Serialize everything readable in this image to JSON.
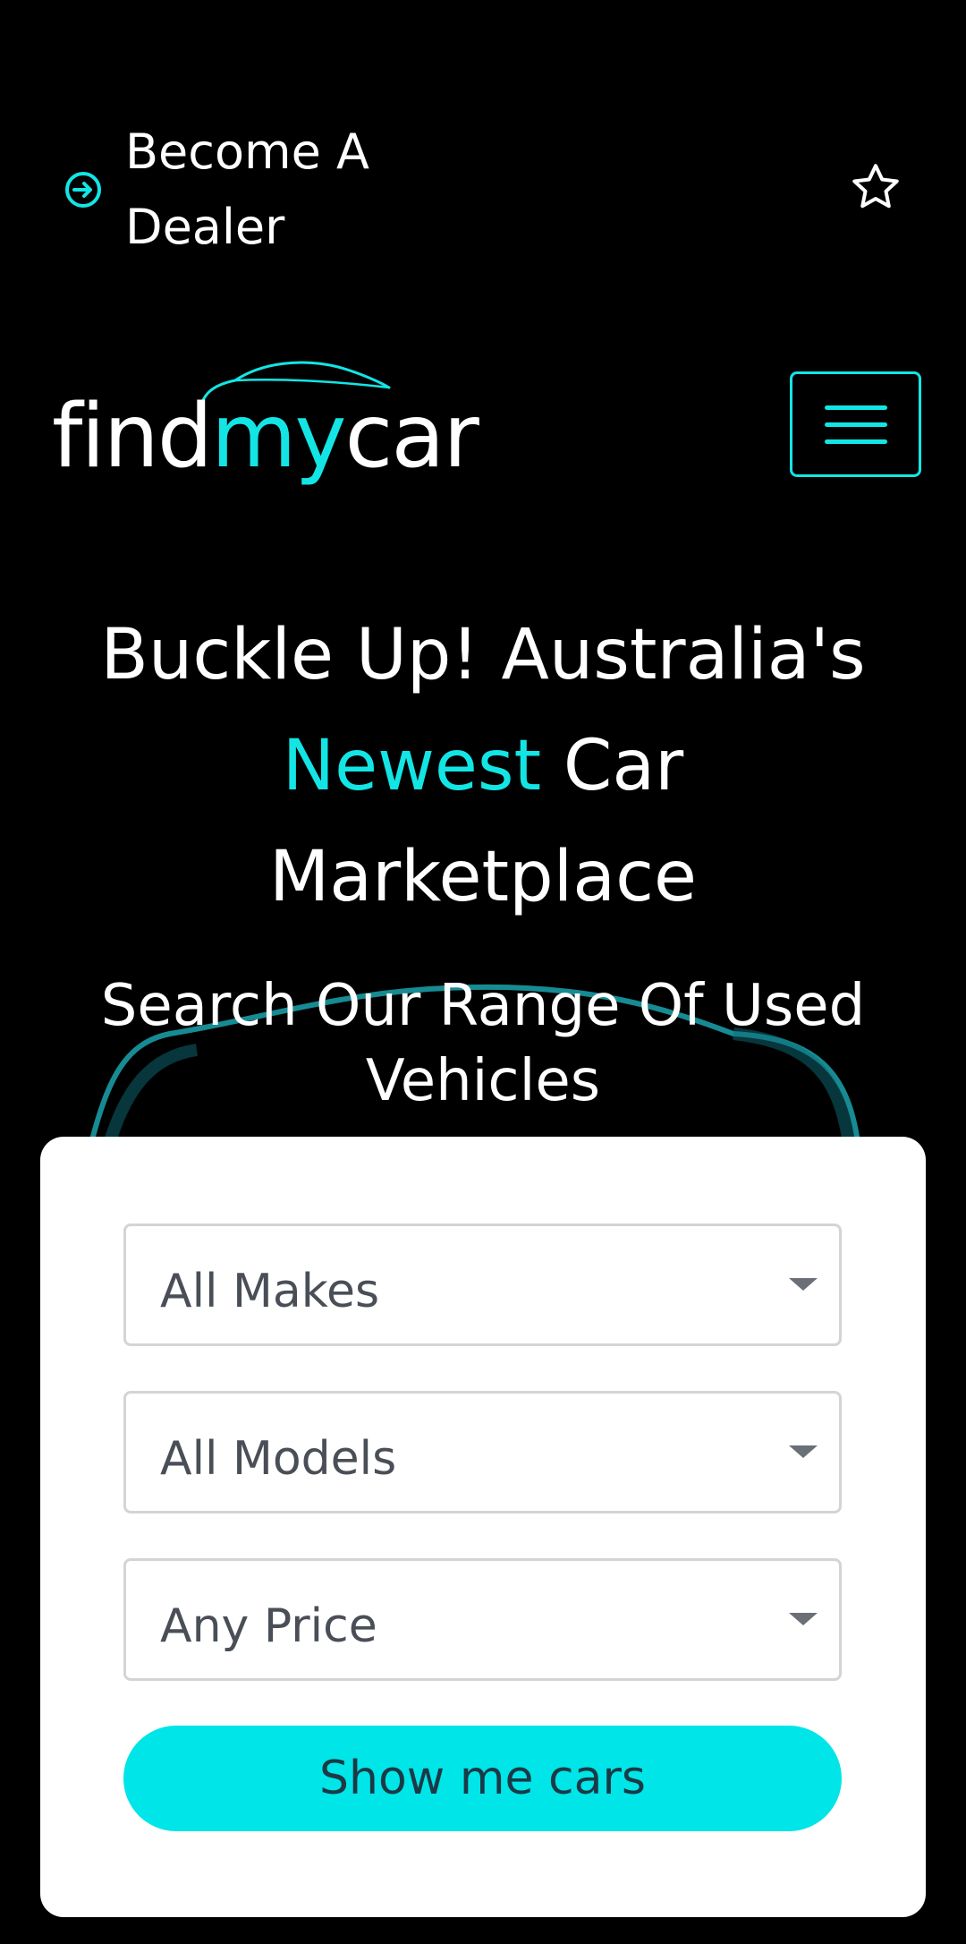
{
  "header": {
    "dealer_link_label": "Become A Dealer",
    "dealer_icon": "arrow-right-circle-icon",
    "favorites_icon": "star-outline-icon",
    "menu_icon": "hamburger-menu-icon"
  },
  "logo": {
    "part1": "find",
    "part2": "my",
    "part3": "car"
  },
  "hero": {
    "title_line1": "Buckle Up! Australia's",
    "title_accent": "Newest",
    "title_line2_rest": " Car",
    "title_line3": "Marketplace",
    "subtitle": "Search Our Range Of Used Vehicles"
  },
  "search": {
    "make_value": "All Makes",
    "model_value": "All Models",
    "price_value": "Any Price",
    "submit_label": "Show me cars"
  },
  "colors": {
    "accent": "#13e5e5",
    "button": "#00e5e8",
    "background": "#000000",
    "card": "#ffffff"
  }
}
